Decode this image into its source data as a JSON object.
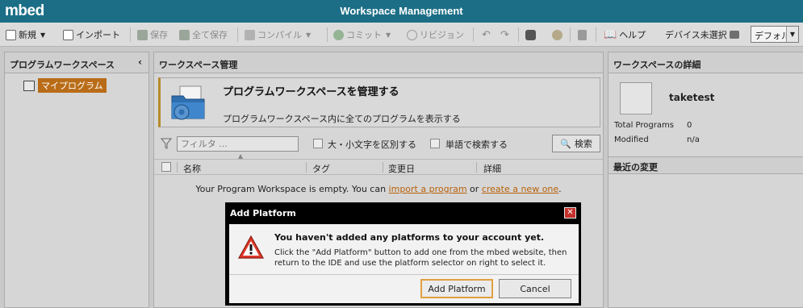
{
  "app": {
    "logo": "mbed",
    "title": "Workspace Management"
  },
  "toolbar": {
    "new_label": "新規",
    "import_label": "インポート",
    "save_label": "保存",
    "save_all_label": "全て保存",
    "compile_label": "コンパイル",
    "commit_label": "コミット",
    "revision_label": "リビジョン",
    "help_label": "ヘルプ",
    "device_label": "デバイス未選択",
    "profile_value": "デフォルト"
  },
  "left_panel": {
    "title": "プログラムワークスペース",
    "items": [
      {
        "label": "マイプログラム"
      }
    ]
  },
  "main_panel": {
    "title": "ワークスペース管理",
    "banner": {
      "title": "プログラムワークスペースを管理する",
      "subtitle": "プログラムワークスペース内に全てのプログラムを表示する"
    },
    "filter": {
      "placeholder": "フィルタ ...",
      "case_label": "大・小文字を区別する",
      "word_label": "単語で検索する",
      "search_button": "検索"
    },
    "columns": [
      "名称",
      "タグ",
      "変更日",
      "詳細"
    ],
    "empty": {
      "prefix": "Your Program Workspace is empty. You can ",
      "link1": "import a program",
      "middle": " or ",
      "link2": "create a new one",
      "suffix": "."
    }
  },
  "right_panel": {
    "title": "ワークスペースの詳細",
    "workspace_name": "taketest",
    "total_programs_label": "Total Programs",
    "total_programs_value": "0",
    "modified_label": "Modified",
    "modified_value": "n/a",
    "recent_title": "最近の変更"
  },
  "dialog": {
    "title": "Add Platform",
    "heading": "You haven't added any platforms to your account yet.",
    "message": "Click the \"Add Platform\" button to add one from the mbed website, then return to the IDE and use the platform selector on right to select it.",
    "primary_button": "Add Platform",
    "cancel_button": "Cancel"
  },
  "colors": {
    "title_bar": "#1b6e86",
    "accent": "#b96c17",
    "link": "#b8620c",
    "close": "#c4302b"
  }
}
